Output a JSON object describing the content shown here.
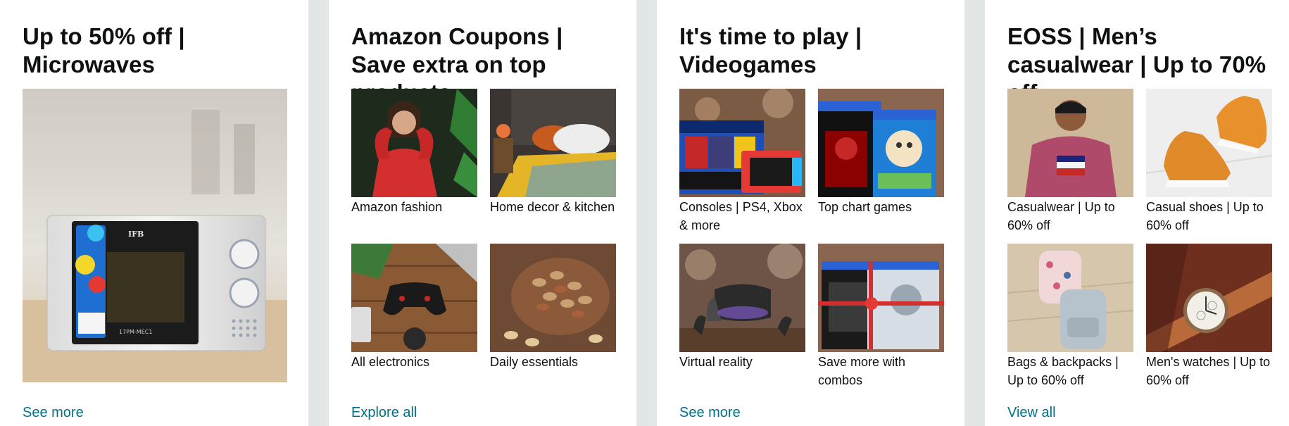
{
  "cards": [
    {
      "title": "Up to 50% off | Microwaves",
      "link": "See more",
      "hero_label": "IFB",
      "hero_model": "17PM-MEC1"
    },
    {
      "title": "Amazon Coupons | Save extra on top products",
      "link": "Explore all",
      "tiles": [
        {
          "label": "Amazon fashion"
        },
        {
          "label": "Home decor & kitchen"
        },
        {
          "label": "All electronics"
        },
        {
          "label": "Daily essentials"
        }
      ]
    },
    {
      "title": "It's time to play | Videogames",
      "link": "See more",
      "tiles": [
        {
          "label": "Consoles | PS4, Xbox & more"
        },
        {
          "label": "Top chart games"
        },
        {
          "label": "Virtual reality"
        },
        {
          "label": "Save more with combos"
        }
      ]
    },
    {
      "title": "EOSS | Men’s casualwear | Up to 70% off",
      "link": "View all",
      "tiles": [
        {
          "label": "Casualwear | Up to 60% off"
        },
        {
          "label": "Casual shoes | Up to 60% off"
        },
        {
          "label": "Bags & backpacks | Up to 60% off"
        },
        {
          "label": "Men's watches | Up to 60% off"
        }
      ]
    }
  ],
  "colors": {
    "page_bg": "#e3e6e6",
    "card_bg": "#ffffff",
    "link": "#007185",
    "text": "#0f1111"
  }
}
